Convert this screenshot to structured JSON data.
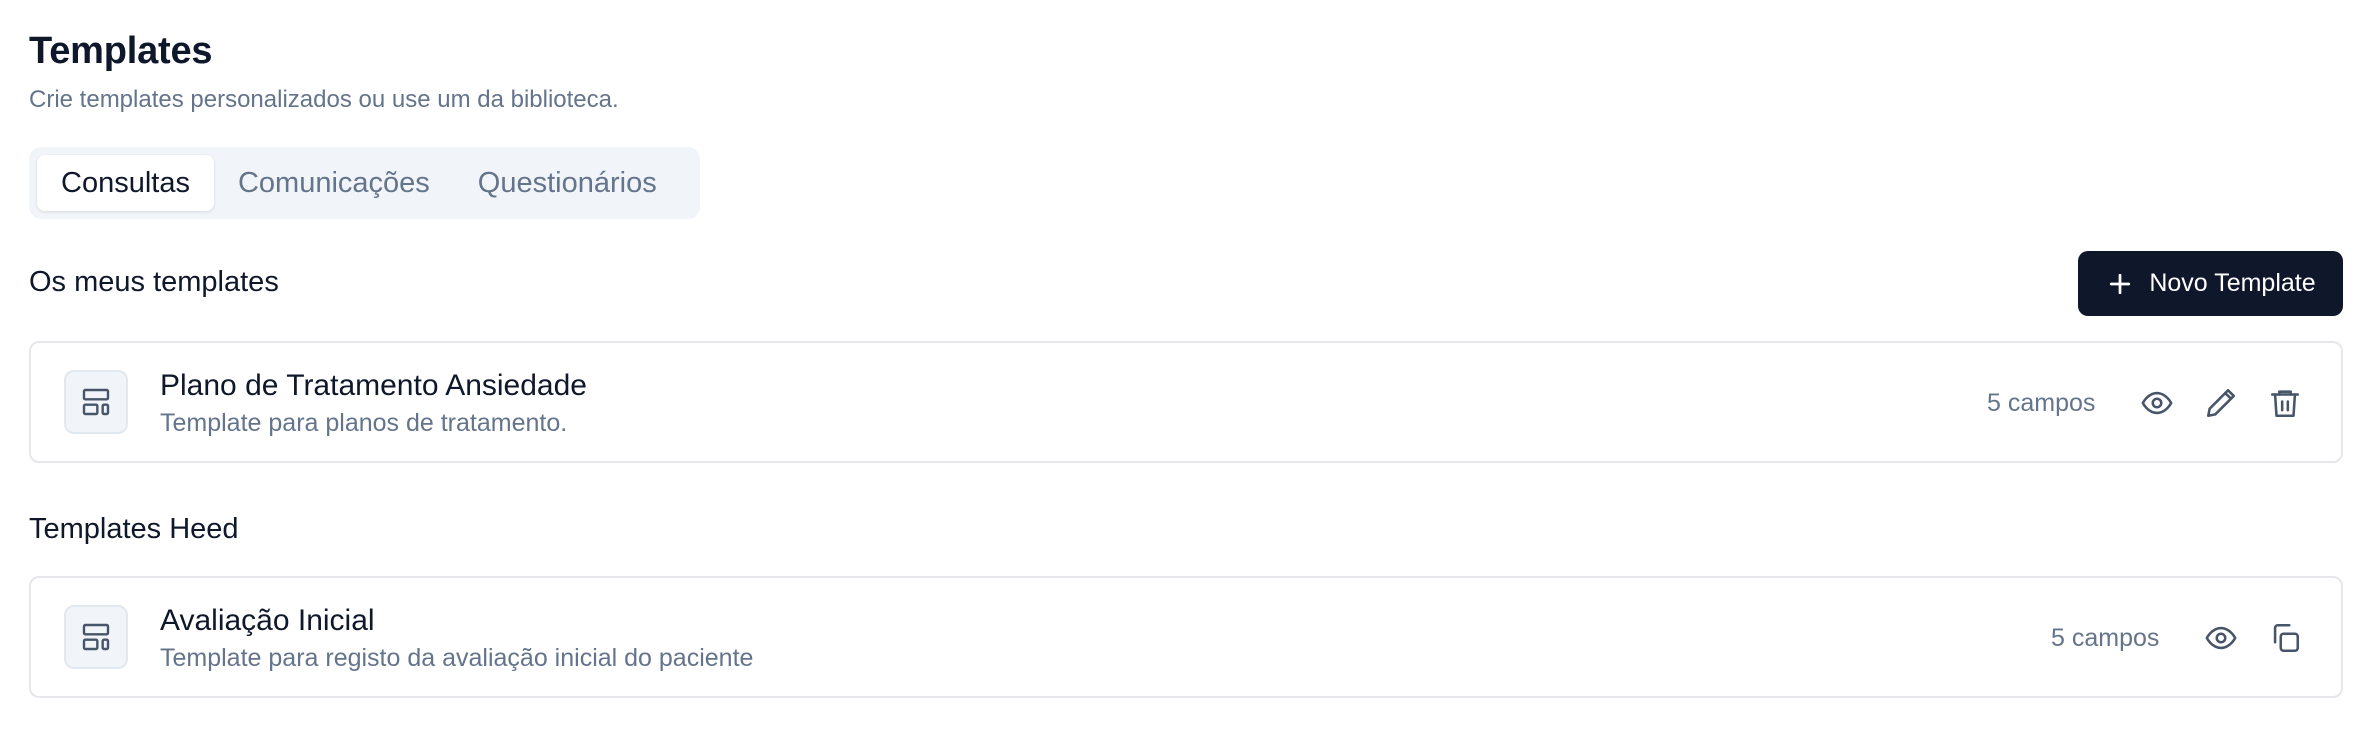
{
  "header": {
    "title": "Templates",
    "subtitle": "Crie templates personalizados ou use um da biblioteca."
  },
  "tabs": [
    {
      "label": "Consultas",
      "active": true
    },
    {
      "label": "Comunicações",
      "active": false
    },
    {
      "label": "Questionários",
      "active": false
    }
  ],
  "my_templates": {
    "title": "Os meus templates",
    "new_button_label": "Novo Template",
    "items": [
      {
        "icon": "layout-template-icon",
        "name": "Plano de Tratamento Ansiedade",
        "description": "Template para planos de tratamento.",
        "field_count": "5 campos",
        "actions": [
          "eye-icon",
          "pencil-icon",
          "trash-icon"
        ]
      }
    ]
  },
  "heed_templates": {
    "title": "Templates Heed",
    "items": [
      {
        "icon": "layout-template-icon",
        "name": "Avaliação Inicial",
        "description": "Template para registo da avaliação inicial do paciente",
        "field_count": "5 campos",
        "actions": [
          "eye-icon",
          "copy-icon"
        ]
      }
    ]
  },
  "colors": {
    "primary": "#0f172a",
    "muted_text": "#64748b",
    "border": "#e5e7eb",
    "tab_background": "#f1f5f9"
  }
}
